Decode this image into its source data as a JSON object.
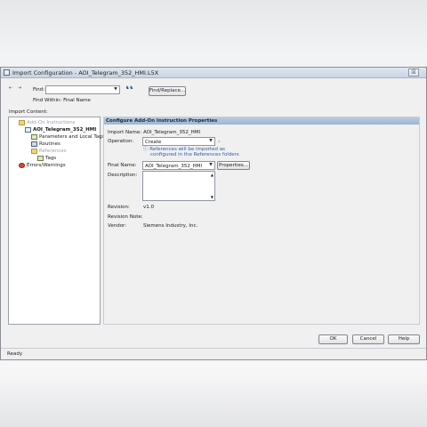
{
  "window": {
    "title": "Import Configuration - AOI_Telegram_352_HMI.L5X",
    "close_glyph": "☒"
  },
  "find": {
    "label": "Find:",
    "value": "",
    "within_label": "Find Within: Final Name",
    "replace_button": "Find/Replace..."
  },
  "import_content_label": "Import Content:",
  "tree": {
    "root": "Add-On Instructions",
    "aoi": "AOI_Telegram_352_HMI",
    "params": "Parameters and Local Tags",
    "routines": "Routines",
    "references": "References",
    "tags": "Tags",
    "errors": "Errors/Warnings"
  },
  "section": {
    "title": "Configure Add-On Instruction Properties"
  },
  "form": {
    "import_name_label": "Import Name:",
    "import_name_value": "AOI_Telegram_352_HMI",
    "operation_label": "Operation:",
    "operation_value": "Create",
    "operation_note_line1": "References will be imported as",
    "operation_note_line2": "configured in the References folders",
    "final_name_label": "Final Name:",
    "final_name_value": "AOI_Telegram_352_HMI",
    "properties_button": "Properties...",
    "description_label": "Description:",
    "revision_label": "Revision:",
    "revision_value": "v1.0",
    "revision_note_label": "Revision Note:",
    "vendor_label": "Vendor:",
    "vendor_value": "Siemens Industry, Inc."
  },
  "buttons": {
    "ok": "OK",
    "cancel": "Cancel",
    "help": "Help"
  },
  "status": {
    "text": "Ready"
  }
}
